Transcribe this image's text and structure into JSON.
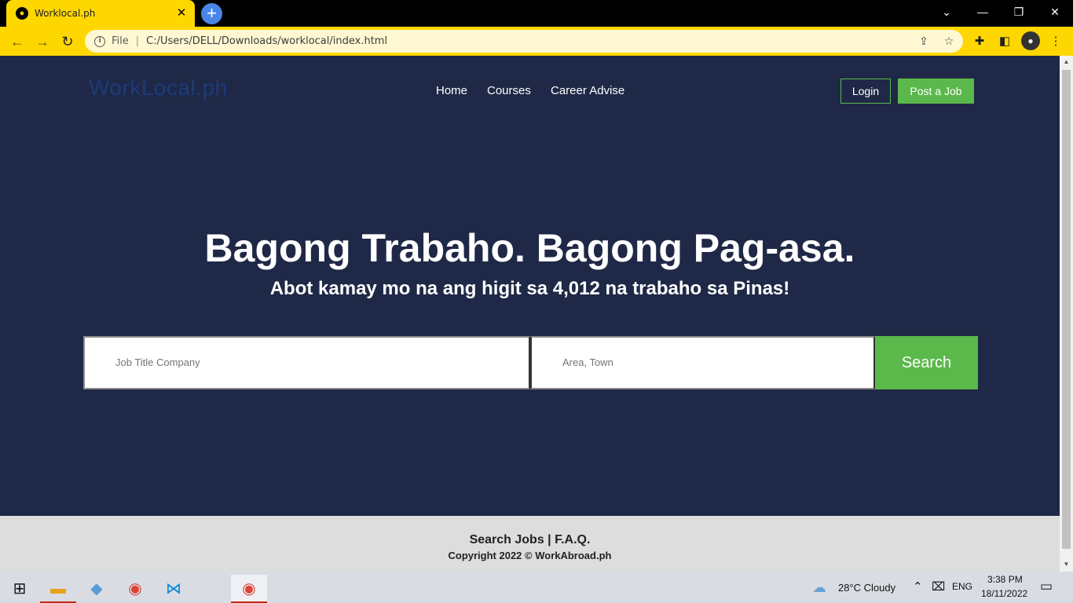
{
  "browser": {
    "tab_title": "Worklocal.ph",
    "tab_close": "✕",
    "new_tab": "+",
    "url_scheme_label": "File",
    "url": "C:/Users/DELL/Downloads/worklocal/index.html",
    "window_controls": {
      "dropdown": "⌄",
      "minimize": "—",
      "restore": "❐",
      "close": "✕"
    }
  },
  "site": {
    "logo": "WorkLocal.ph",
    "nav": [
      "Home",
      "Courses",
      "Career Advise"
    ],
    "login_label": "Login",
    "post_job_label": "Post a Job"
  },
  "hero": {
    "title": "Bagong Trabaho. Bagong Pag-asa.",
    "subtitle": "Abot kamay mo na ang higit sa 4,012 na trabaho sa Pinas!",
    "job_placeholder": "Job Title Company",
    "area_placeholder": "Area, Town",
    "search_label": "Search"
  },
  "footer": {
    "links": "Search Jobs | F.A.Q.",
    "copyright": "Copyright 2022 © WorkAbroad.ph"
  },
  "taskbar": {
    "weather": "28°C  Cloudy",
    "language": "ENG",
    "time": "3:38 PM",
    "date": "18/11/2022"
  },
  "colors": {
    "page_bg": "#1f2947",
    "accent_green": "#5bb84b",
    "browser_theme": "#ffd700",
    "logo": "#1c3b7a"
  }
}
